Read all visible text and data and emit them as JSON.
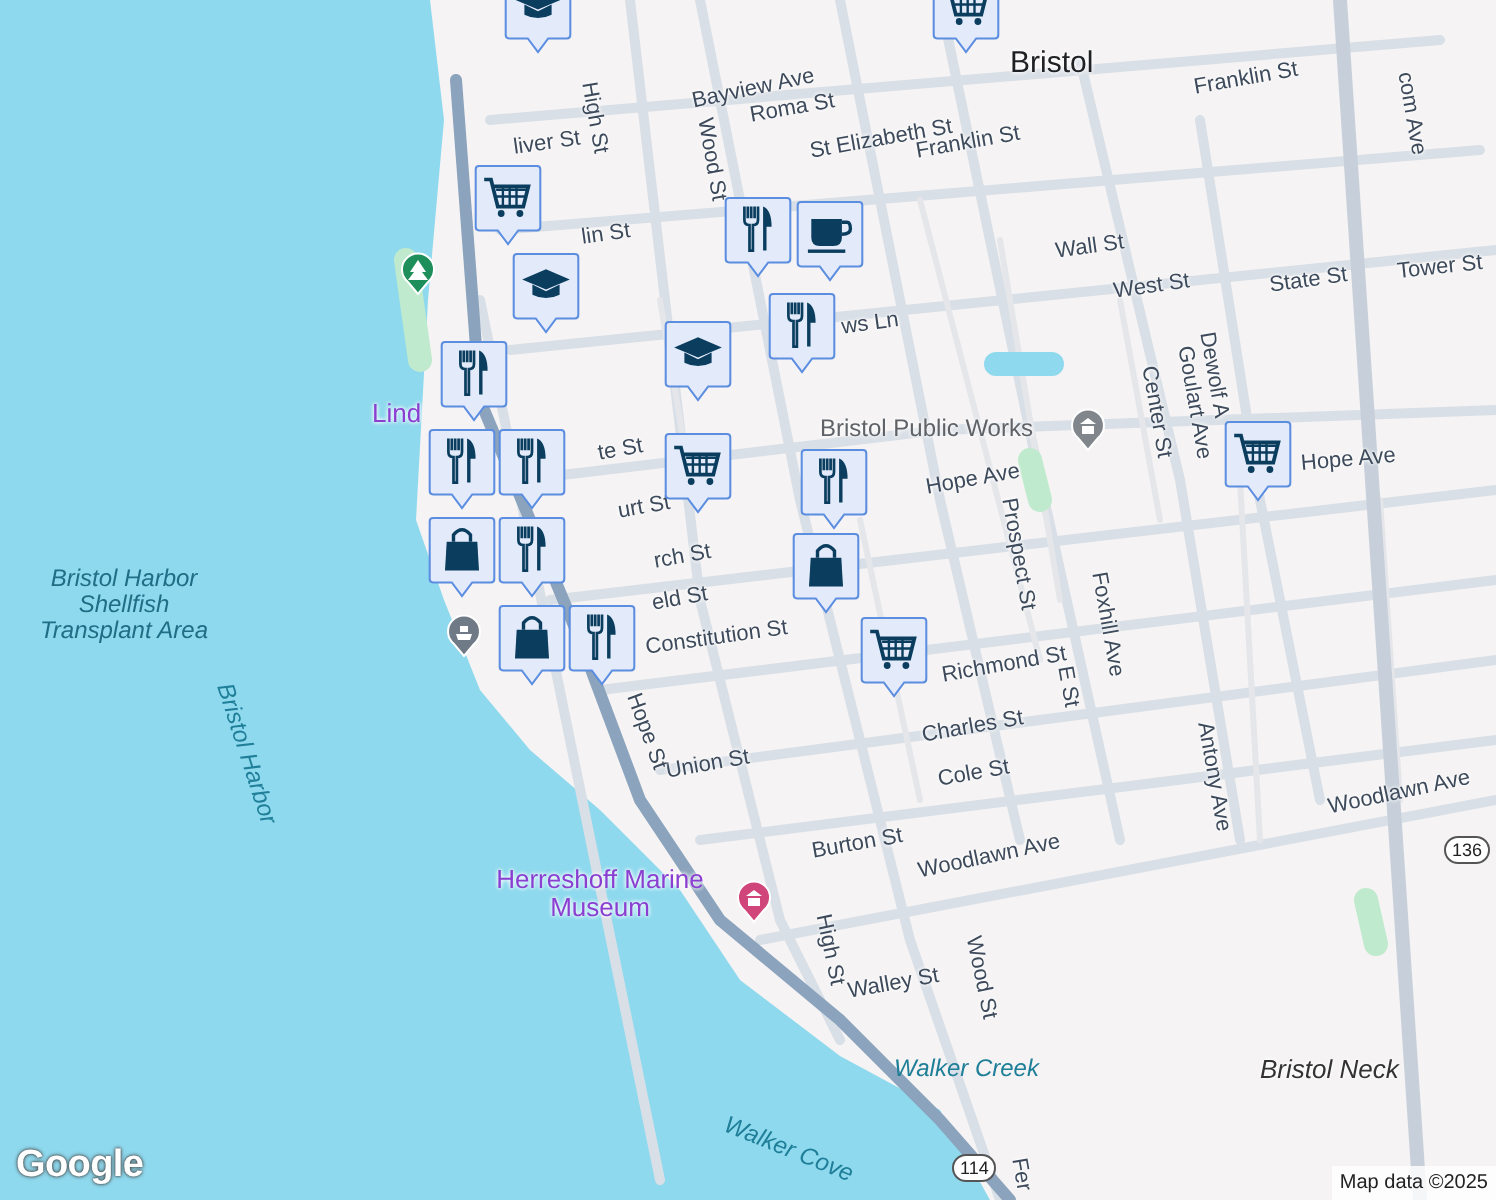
{
  "map": {
    "labels": [
      {
        "text": "Bayview Ave",
        "kind": "street"
      },
      {
        "text": "Bristol",
        "kind": "town"
      },
      {
        "text": "Roma St",
        "kind": "street"
      },
      {
        "text": "St Elizabeth St",
        "kind": "street"
      },
      {
        "text": "Franklin St",
        "kind": "street"
      },
      {
        "text": "Franklin St",
        "kind": "street"
      },
      {
        "text": "liver St",
        "kind": "street"
      },
      {
        "text": "lin St",
        "kind": "street"
      },
      {
        "text": "Wall St",
        "kind": "street"
      },
      {
        "text": "West St",
        "kind": "street"
      },
      {
        "text": "State St",
        "kind": "street"
      },
      {
        "text": "Tower St",
        "kind": "street"
      },
      {
        "text": "ws Ln",
        "kind": "street"
      },
      {
        "text": "High St",
        "kind": "street"
      },
      {
        "text": "Wood St",
        "kind": "street"
      },
      {
        "text": "Lind",
        "kind": "poi"
      },
      {
        "text": "Bristol Public Works",
        "kind": "public"
      },
      {
        "text": "te St",
        "kind": "street"
      },
      {
        "text": "urt St",
        "kind": "street"
      },
      {
        "text": "rch St",
        "kind": "street"
      },
      {
        "text": "eld St",
        "kind": "street"
      },
      {
        "text": "Hope Ave",
        "kind": "street"
      },
      {
        "text": "Hope Ave",
        "kind": "street"
      },
      {
        "text": "Center St",
        "kind": "street"
      },
      {
        "text": "Goulart Ave",
        "kind": "street"
      },
      {
        "text": "Dewolf A",
        "kind": "street"
      },
      {
        "text": "Prospect St",
        "kind": "street"
      },
      {
        "text": "Foxhill Ave",
        "kind": "street"
      },
      {
        "text": "Antony Ave",
        "kind": "street"
      },
      {
        "text": "E St",
        "kind": "street"
      },
      {
        "text": "Richmond St",
        "kind": "street"
      },
      {
        "text": "Constitution St",
        "kind": "street"
      },
      {
        "text": "Charles St",
        "kind": "street"
      },
      {
        "text": "Cole St",
        "kind": "street"
      },
      {
        "text": "Union St",
        "kind": "street"
      },
      {
        "text": "Burton St",
        "kind": "street"
      },
      {
        "text": "Woodlawn Ave",
        "kind": "street"
      },
      {
        "text": "Woodlawn Ave",
        "kind": "street"
      },
      {
        "text": "High St",
        "kind": "street"
      },
      {
        "text": "Wood St",
        "kind": "street"
      },
      {
        "text": "Walley St",
        "kind": "street"
      },
      {
        "text": "Hope St",
        "kind": "street"
      },
      {
        "text": "Herreshoff Marine Museum",
        "kind": "poi"
      },
      {
        "text": "Walker Creek",
        "kind": "water"
      },
      {
        "text": "Walker Cove",
        "kind": "water"
      },
      {
        "text": "Bristol Neck",
        "kind": "area"
      },
      {
        "text": "Bristol Harbor Shellfish Transplant Area",
        "kind": "area"
      },
      {
        "text": "Bristol Harbor",
        "kind": "water"
      },
      {
        "text": "com Ave",
        "kind": "street"
      },
      {
        "text": "Fer",
        "kind": "street"
      }
    ],
    "shields": [
      {
        "text": "114"
      },
      {
        "text": "136"
      }
    ],
    "places": [
      {
        "kind": "park"
      },
      {
        "kind": "civic"
      },
      {
        "kind": "ferry"
      },
      {
        "kind": "museum"
      }
    ],
    "pins": [
      {
        "kind": "cart"
      },
      {
        "kind": "school"
      },
      {
        "kind": "cart"
      },
      {
        "kind": "food"
      },
      {
        "kind": "cafe"
      },
      {
        "kind": "school"
      },
      {
        "kind": "food"
      },
      {
        "kind": "food"
      },
      {
        "kind": "school"
      },
      {
        "kind": "food"
      },
      {
        "kind": "food"
      },
      {
        "kind": "cart"
      },
      {
        "kind": "food"
      },
      {
        "kind": "bag"
      },
      {
        "kind": "food"
      },
      {
        "kind": "bag"
      },
      {
        "kind": "bag"
      },
      {
        "kind": "cart"
      },
      {
        "kind": "cart"
      },
      {
        "kind": "food"
      }
    ]
  },
  "logo": "Google",
  "attribution": "Map data ©2025"
}
